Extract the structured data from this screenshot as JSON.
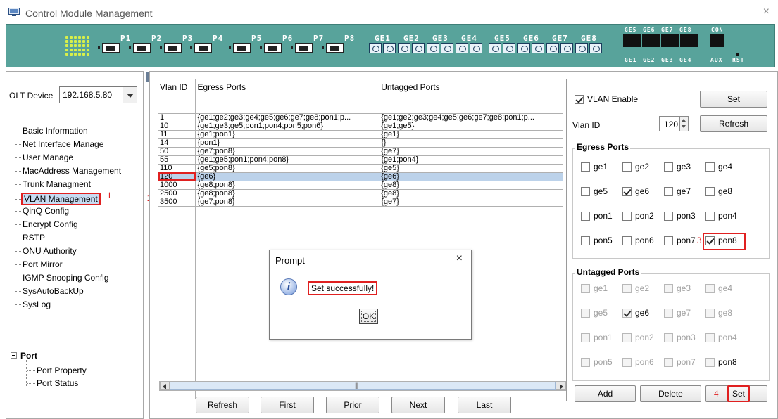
{
  "window": {
    "title": "Control Module Management",
    "close_label": "×"
  },
  "device": {
    "ports": [
      "P1",
      "P2",
      "P3",
      "P4",
      "P5",
      "P6",
      "P7",
      "P8"
    ],
    "ge_ports": [
      "GE1",
      "GE2",
      "GE3",
      "GE4",
      "GE5",
      "GE6",
      "GE7",
      "GE8"
    ],
    "top_labels": [
      "GE5",
      "GE6",
      "GE7",
      "GE8"
    ],
    "bottom_labels": [
      "GE1",
      "GE2",
      "GE3",
      "GE4"
    ],
    "con_label": "CON",
    "aux_label": "AUX",
    "rst_label": "RST"
  },
  "olt": {
    "label": "OLT Device",
    "value": "192.168.5.80"
  },
  "tree": {
    "items": [
      "Basic Information",
      "Net Interface Manage",
      "User Manage",
      "MacAddress Management",
      "Trunk Managment",
      "VLAN Management",
      "QinQ Config",
      "Encrypt Config",
      "RSTP",
      "ONU Authority",
      "Port Mirror",
      "IGMP Snooping Config",
      "SysAutoBackUp",
      "SysLog"
    ],
    "port_group": "Port",
    "port_children": [
      "Port Property",
      "Port Status"
    ]
  },
  "table": {
    "headers": [
      "Vlan ID",
      "Egress Ports",
      "Untagged Ports"
    ],
    "rows": [
      [
        "1",
        "{ge1;ge2;ge3;ge4;ge5;ge6;ge7;ge8;pon1;p...",
        "{ge1;ge2;ge3;ge4;ge5;ge6;ge7;ge8;pon1;p..."
      ],
      [
        "10",
        "{ge1;ge3;ge5;pon1;pon4;pon5;pon6}",
        "{ge1;ge5}"
      ],
      [
        "11",
        "{ge1;pon1}",
        "{ge1}"
      ],
      [
        "14",
        "{pon1}",
        "{}"
      ],
      [
        "50",
        "{ge7;pon8}",
        "{ge7}"
      ],
      [
        "55",
        "{ge1;ge5;pon1;pon4;pon8}",
        "{ge1;pon4}"
      ],
      [
        "110",
        "{ge5;pon8}",
        "{ge5}"
      ],
      [
        "120",
        "{ge6}",
        "{ge6}"
      ],
      [
        "1000",
        "{ge8;pon8}",
        "{ge8}"
      ],
      [
        "2500",
        "{ge8;pon8}",
        "{ge8}"
      ],
      [
        "3500",
        "{ge7;pon8}",
        "{ge7}"
      ]
    ],
    "selected_vlan": "120"
  },
  "pager": {
    "refresh": "Refresh",
    "first": "First",
    "prior": "Prior",
    "next": "Next",
    "last": "Last"
  },
  "config": {
    "vlan_enable_label": "VLAN Enable",
    "set_label": "Set",
    "vlan_id_label": "Vlan ID",
    "vlan_id_value": "120",
    "refresh_label": "Refresh",
    "egress_title": "Egress Ports",
    "untagged_title": "Untagged Ports",
    "port_names": [
      "ge1",
      "ge2",
      "ge3",
      "ge4",
      "ge5",
      "ge6",
      "ge7",
      "ge8",
      "pon1",
      "pon2",
      "pon3",
      "pon4",
      "pon5",
      "pon6",
      "pon7",
      "pon8"
    ],
    "egress_checked": [
      "ge6",
      "pon8"
    ],
    "untagged_checked": [
      "ge6"
    ],
    "add_label": "Add",
    "delete_label": "Delete",
    "bottom_set_label": "Set"
  },
  "annotations": {
    "step1": "1",
    "step2": "2",
    "step3": "3",
    "step4": "4"
  },
  "dialog": {
    "title": "Prompt",
    "message": "Set successfully!",
    "ok": "OK",
    "close": "×"
  },
  "colors": {
    "banner": "#58a39b",
    "selection": "#bcd2ea",
    "annotation": "#e02020"
  }
}
